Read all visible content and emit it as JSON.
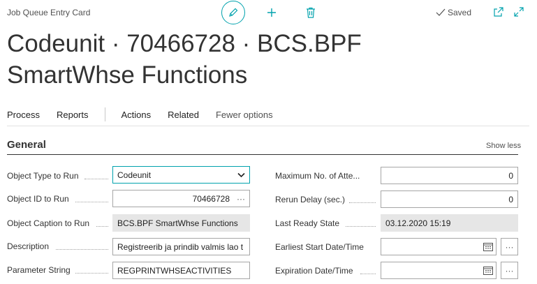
{
  "header": {
    "page_type": "Job Queue Entry Card",
    "saved_label": "Saved",
    "title": "Codeunit · 70466728 · BCS.BPF SmartWhse Functions"
  },
  "actions": {
    "process": "Process",
    "reports": "Reports",
    "actions": "Actions",
    "related": "Related",
    "fewer_options": "Fewer options"
  },
  "general": {
    "title": "General",
    "show_less": "Show less",
    "left_fields": [
      {
        "label": "Object Type to Run",
        "value": "Codeunit"
      },
      {
        "label": "Object ID to Run",
        "value": "70466728",
        "assist": "···"
      },
      {
        "label": "Object Caption to Run",
        "value": "BCS.BPF SmartWhse Functions"
      },
      {
        "label": "Description",
        "value": "Registreerib ja prindib valmis lao t"
      },
      {
        "label": "Parameter String",
        "value": "REGPRINTWHSEACTIVITIES"
      }
    ],
    "right_fields": [
      {
        "label": "Maximum No. of Atte...",
        "value": "0"
      },
      {
        "label": "Rerun Delay (sec.)",
        "value": "0"
      },
      {
        "label": "Last Ready State",
        "value": "03.12.2020 15:19"
      },
      {
        "label": "Earliest Start Date/Time",
        "value": "",
        "assist": "···"
      },
      {
        "label": "Expiration Date/Time",
        "value": "",
        "assist": "···"
      }
    ]
  },
  "icons": {
    "edit": "pencil-icon",
    "new": "plus-icon",
    "delete": "trash-icon",
    "saved": "checkmark-icon",
    "open_new_window": "open-in-new-window-icon",
    "expand": "expand-icon",
    "dropdown": "chevron-down-icon",
    "calendar": "calendar-icon"
  },
  "colors": {
    "accent": "#00a2ad",
    "readonly_bg": "#e6e6e6"
  }
}
